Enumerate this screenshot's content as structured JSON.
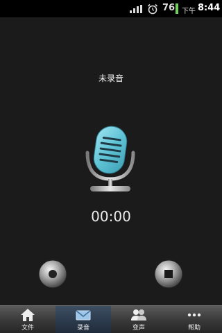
{
  "status_bar": {
    "battery_level": "76",
    "ampm": "下午",
    "time": "8:44",
    "icons": [
      "signal-icon",
      "alarm-icon",
      "battery-icon"
    ]
  },
  "recorder": {
    "status_label": "未录音",
    "timer": "00:00",
    "icons": [
      "microphone-icon",
      "record-icon",
      "stop-icon"
    ]
  },
  "bottom_nav": {
    "tabs": [
      {
        "label": "文件",
        "icon": "home-icon"
      },
      {
        "label": "录音",
        "icon": "envelope-icon"
      },
      {
        "label": "变声",
        "icon": "people-icon"
      },
      {
        "label": "帮助",
        "icon": "more-icon"
      }
    ],
    "active_tab": "录音"
  },
  "colors": {
    "background": "#1b1b1b",
    "mic_accent": "#5fc3d6",
    "active_tab": "#2b3a4c"
  }
}
